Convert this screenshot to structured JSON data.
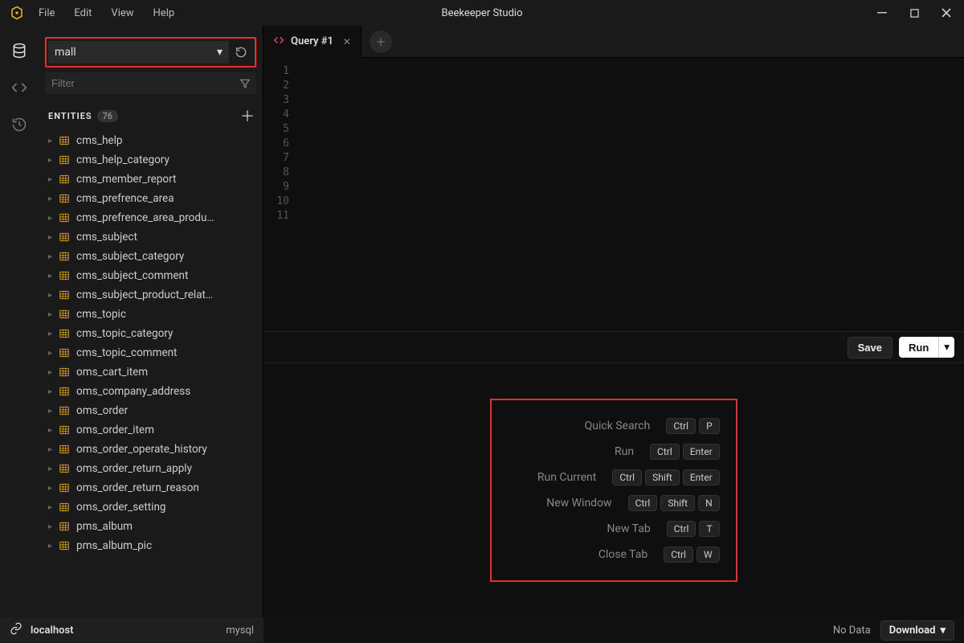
{
  "app_title": "Beekeeper Studio",
  "menu": {
    "file": "File",
    "edit": "Edit",
    "view": "View",
    "help": "Help"
  },
  "sidebar": {
    "db_name": "mall",
    "filter_placeholder": "Filter",
    "entities_label": "ENTITIES",
    "entities_count": "76",
    "tables": [
      "cms_help",
      "cms_help_category",
      "cms_member_report",
      "cms_prefrence_area",
      "cms_prefrence_area_produ…",
      "cms_subject",
      "cms_subject_category",
      "cms_subject_comment",
      "cms_subject_product_relat…",
      "cms_topic",
      "cms_topic_category",
      "cms_topic_comment",
      "oms_cart_item",
      "oms_company_address",
      "oms_order",
      "oms_order_item",
      "oms_order_operate_history",
      "oms_order_return_apply",
      "oms_order_return_reason",
      "oms_order_setting",
      "pms_album",
      "pms_album_pic"
    ]
  },
  "tabs": {
    "query1": "Query #1"
  },
  "editor": {
    "line_count": 11
  },
  "actions": {
    "save": "Save",
    "run": "Run"
  },
  "shortcuts": [
    {
      "name": "Quick Search",
      "keys": [
        "Ctrl",
        "P"
      ]
    },
    {
      "name": "Run",
      "keys": [
        "Ctrl",
        "Enter"
      ]
    },
    {
      "name": "Run Current",
      "keys": [
        "Ctrl",
        "Shift",
        "Enter"
      ]
    },
    {
      "name": "New Window",
      "keys": [
        "Ctrl",
        "Shift",
        "N"
      ]
    },
    {
      "name": "New Tab",
      "keys": [
        "Ctrl",
        "T"
      ]
    },
    {
      "name": "Close Tab",
      "keys": [
        "Ctrl",
        "W"
      ]
    }
  ],
  "status": {
    "host": "localhost",
    "engine": "mysql",
    "no_data": "No Data",
    "download": "Download"
  }
}
